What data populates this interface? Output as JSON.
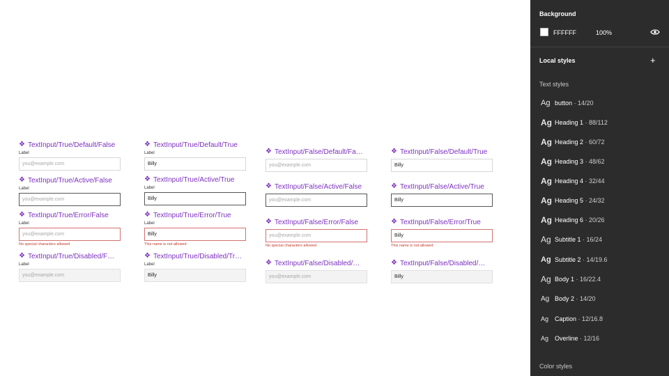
{
  "canvas": {
    "variants": [
      {
        "title": "TextInput/True/Default/False",
        "label": "Label",
        "value": "you@example.com",
        "state": "default",
        "placeholder": true,
        "helper": ""
      },
      {
        "title": "TextInput/True/Active/False",
        "label": "Label",
        "value": "you@example.com",
        "state": "active",
        "placeholder": true,
        "helper": ""
      },
      {
        "title": "TextInput/True/Error/False",
        "label": "Label",
        "value": "you@example.com",
        "state": "error",
        "placeholder": true,
        "helper": "No special characters allowed"
      },
      {
        "title": "TextInput/True/Disabled/Fal...",
        "label": "Label",
        "value": "you@example.com",
        "state": "disabled",
        "placeholder": true,
        "helper": ""
      },
      {
        "title": "TextInput/True/Default/True",
        "label": "Label",
        "value": "Billy",
        "state": "default",
        "placeholder": false,
        "helper": ""
      },
      {
        "title": "TextInput/True/Active/True",
        "label": "Label",
        "value": "Billy",
        "state": "active",
        "placeholder": false,
        "helper": ""
      },
      {
        "title": "TextInput/True/Error/True",
        "label": "Label",
        "value": "Billy",
        "state": "error",
        "placeholder": false,
        "helper": "This name is not allowed"
      },
      {
        "title": "TextInput/True/Disabled/True",
        "label": "Label",
        "value": "Billy",
        "state": "disabled",
        "placeholder": false,
        "helper": ""
      },
      {
        "title": "TextInput/False/Default/False",
        "label": "",
        "value": "you@example.com",
        "state": "default",
        "placeholder": true,
        "helper": ""
      },
      {
        "title": "TextInput/False/Active/False",
        "label": "",
        "value": "you@example.com",
        "state": "active",
        "placeholder": true,
        "helper": ""
      },
      {
        "title": "TextInput/False/Error/False",
        "label": "",
        "value": "you@example.com",
        "state": "error",
        "placeholder": true,
        "helper": "No special characters allowed"
      },
      {
        "title": "TextInput/False/Disabled/Fa...",
        "label": "",
        "value": "you@example.com",
        "state": "disabled",
        "placeholder": true,
        "helper": ""
      },
      {
        "title": "TextInput/False/Default/True",
        "label": "",
        "value": "Billy",
        "state": "default",
        "placeholder": false,
        "helper": ""
      },
      {
        "title": "TextInput/False/Active/True",
        "label": "",
        "value": "Billy",
        "state": "active",
        "placeholder": false,
        "helper": ""
      },
      {
        "title": "TextInput/False/Error/True",
        "label": "",
        "value": "Billy",
        "state": "error",
        "placeholder": false,
        "helper": "This name is not allowed"
      },
      {
        "title": "TextInput/False/Disabled/Tr...",
        "label": "",
        "value": "Billy",
        "state": "disabled",
        "placeholder": false,
        "helper": ""
      }
    ]
  },
  "panel": {
    "background_title": "Background",
    "background_hex": "FFFFFF",
    "background_opacity": "100%",
    "background_color": "#FFFFFF",
    "local_styles_title": "Local styles",
    "add_label": "+",
    "text_styles_title": "Text styles",
    "text_styles": [
      {
        "ag": "Ag",
        "name": "button",
        "spec": " · 14/20"
      },
      {
        "ag": "Ag",
        "name": "Heading 1",
        "spec": " · 88/112"
      },
      {
        "ag": "Ag",
        "name": "Heading 2",
        "spec": " · 60/72"
      },
      {
        "ag": "Ag",
        "name": "Heading 3",
        "spec": " · 48/62"
      },
      {
        "ag": "Ag",
        "name": "Heading 4",
        "spec": " · 32/44"
      },
      {
        "ag": "Ag",
        "name": "Heading 5",
        "spec": " · 24/32"
      },
      {
        "ag": "Ag",
        "name": "Heading 6",
        "spec": " · 20/26"
      },
      {
        "ag": "Ag",
        "name": "Subtitle 1",
        "spec": " · 16/24"
      },
      {
        "ag": "Ag",
        "name": "Subtitle 2",
        "spec": " · 14/19.6"
      },
      {
        "ag": "Ag",
        "name": "Body 1",
        "spec": " · 16/22.4"
      },
      {
        "ag": "Ag",
        "name": "Body 2",
        "spec": " · 14/20"
      },
      {
        "ag": "Ag",
        "name": "Caption",
        "spec": " · 12/16.8"
      },
      {
        "ag": "Ag",
        "name": "Overline",
        "spec": " · 12/16"
      }
    ],
    "color_styles_title": "Color styles"
  },
  "colors": {
    "component_purple": "#7B2FBF",
    "panel_bg": "#2C2C2C",
    "error": "#D27070"
  },
  "icons": [
    "component-diamond-icon",
    "eye-icon",
    "plus-icon"
  ]
}
